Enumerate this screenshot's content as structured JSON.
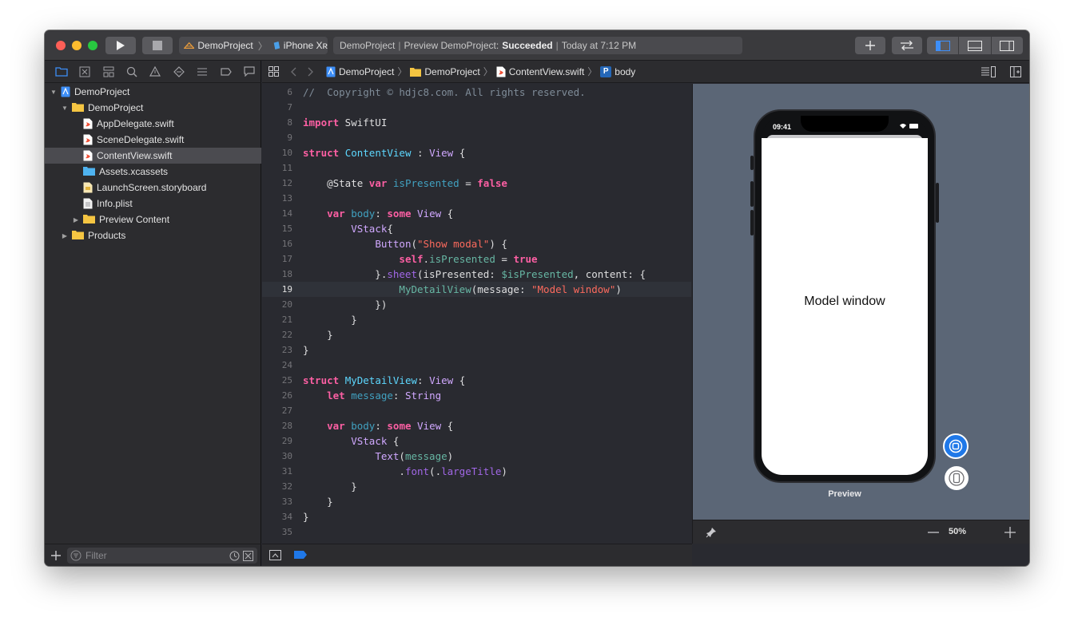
{
  "toolbar": {
    "scheme_project": "DemoProject",
    "scheme_device": "iPhone Xʀ",
    "status_project": "DemoProject",
    "status_message_prefix": "Preview DemoProject:",
    "status_result": "Succeeded",
    "status_time": "Today at 7:12 PM"
  },
  "navigator": {
    "items": [
      {
        "label": "DemoProject",
        "depth": 0,
        "kind": "project",
        "disclosure": "open"
      },
      {
        "label": "DemoProject",
        "depth": 1,
        "kind": "folder",
        "disclosure": "open"
      },
      {
        "label": "AppDelegate.swift",
        "depth": 2,
        "kind": "swift"
      },
      {
        "label": "SceneDelegate.swift",
        "depth": 2,
        "kind": "swift"
      },
      {
        "label": "ContentView.swift",
        "depth": 2,
        "kind": "swift",
        "selected": true
      },
      {
        "label": "Assets.xcassets",
        "depth": 2,
        "kind": "assets"
      },
      {
        "label": "LaunchScreen.storyboard",
        "depth": 2,
        "kind": "storyboard"
      },
      {
        "label": "Info.plist",
        "depth": 2,
        "kind": "plist"
      },
      {
        "label": "Preview Content",
        "depth": 2,
        "kind": "folder",
        "disclosure": "closed"
      },
      {
        "label": "Products",
        "depth": 1,
        "kind": "folder",
        "disclosure": "closed"
      }
    ],
    "filter_placeholder": "Filter"
  },
  "jumpbar": {
    "crumbs": [
      "DemoProject",
      "DemoProject",
      "ContentView.swift",
      "body"
    ],
    "symbol_letter": "P"
  },
  "editor": {
    "current_line": 19,
    "lines": [
      {
        "n": "6",
        "tokens": [
          [
            "cm",
            "//  Copyright © hdjc8.com. All rights reserved."
          ]
        ]
      },
      {
        "n": "7",
        "tokens": []
      },
      {
        "n": "8",
        "tokens": [
          [
            "kw",
            "import"
          ],
          [
            "at",
            " SwiftUI"
          ]
        ]
      },
      {
        "n": "9",
        "tokens": []
      },
      {
        "n": "10",
        "tokens": [
          [
            "kw",
            "struct"
          ],
          [
            "at",
            " "
          ],
          [
            "ty",
            "ContentView"
          ],
          [
            "at",
            " : "
          ],
          [
            "pl",
            "View"
          ],
          [
            "at",
            " {"
          ]
        ]
      },
      {
        "n": "11",
        "tokens": []
      },
      {
        "n": "12",
        "tokens": [
          [
            "at",
            "    @State "
          ],
          [
            "kw",
            "var"
          ],
          [
            "at",
            " "
          ],
          [
            "vr",
            "isPresented"
          ],
          [
            "at",
            " = "
          ],
          [
            "kw",
            "false"
          ]
        ]
      },
      {
        "n": "13",
        "tokens": []
      },
      {
        "n": "14",
        "tokens": [
          [
            "at",
            "    "
          ],
          [
            "kw",
            "var"
          ],
          [
            "at",
            " "
          ],
          [
            "vr",
            "body"
          ],
          [
            "at",
            ": "
          ],
          [
            "kw",
            "some"
          ],
          [
            "at",
            " "
          ],
          [
            "pl",
            "View"
          ],
          [
            "at",
            " {"
          ]
        ]
      },
      {
        "n": "15",
        "tokens": [
          [
            "at",
            "        "
          ],
          [
            "pl",
            "VStack"
          ],
          [
            "at",
            "{"
          ]
        ]
      },
      {
        "n": "16",
        "tokens": [
          [
            "at",
            "            "
          ],
          [
            "pl",
            "Button"
          ],
          [
            "at",
            "("
          ],
          [
            "st",
            "\"Show modal\""
          ],
          [
            "at",
            ") {"
          ]
        ]
      },
      {
        "n": "17",
        "tokens": [
          [
            "at",
            "                "
          ],
          [
            "kw",
            "self"
          ],
          [
            "at",
            "."
          ],
          [
            "fn",
            "isPresented"
          ],
          [
            "at",
            " = "
          ],
          [
            "kw",
            "true"
          ]
        ]
      },
      {
        "n": "18",
        "tokens": [
          [
            "at",
            "            }."
          ],
          [
            "cu",
            "sheet"
          ],
          [
            "at",
            "(isPresented: "
          ],
          [
            "fn",
            "$isPresented"
          ],
          [
            "at",
            ", content: {"
          ]
        ]
      },
      {
        "n": "19",
        "tokens": [
          [
            "at",
            "                "
          ],
          [
            "fn",
            "MyDetailView"
          ],
          [
            "at",
            "(message: "
          ],
          [
            "st",
            "\"Model window\""
          ],
          [
            "at",
            ")"
          ]
        ]
      },
      {
        "n": "20",
        "tokens": [
          [
            "at",
            "            })"
          ]
        ]
      },
      {
        "n": "21",
        "tokens": [
          [
            "at",
            "        }"
          ]
        ]
      },
      {
        "n": "22",
        "tokens": [
          [
            "at",
            "    }"
          ]
        ]
      },
      {
        "n": "23",
        "tokens": [
          [
            "at",
            "}"
          ]
        ]
      },
      {
        "n": "24",
        "tokens": []
      },
      {
        "n": "25",
        "tokens": [
          [
            "kw",
            "struct"
          ],
          [
            "at",
            " "
          ],
          [
            "ty",
            "MyDetailView"
          ],
          [
            "at",
            ": "
          ],
          [
            "pl",
            "View"
          ],
          [
            "at",
            " {"
          ]
        ]
      },
      {
        "n": "26",
        "tokens": [
          [
            "at",
            "    "
          ],
          [
            "kw",
            "let"
          ],
          [
            "at",
            " "
          ],
          [
            "vr",
            "message"
          ],
          [
            "at",
            ": "
          ],
          [
            "pl",
            "String"
          ]
        ]
      },
      {
        "n": "27",
        "tokens": []
      },
      {
        "n": "28",
        "tokens": [
          [
            "at",
            "    "
          ],
          [
            "kw",
            "var"
          ],
          [
            "at",
            " "
          ],
          [
            "vr",
            "body"
          ],
          [
            "at",
            ": "
          ],
          [
            "kw",
            "some"
          ],
          [
            "at",
            " "
          ],
          [
            "pl",
            "View"
          ],
          [
            "at",
            " {"
          ]
        ]
      },
      {
        "n": "29",
        "tokens": [
          [
            "at",
            "        "
          ],
          [
            "pl",
            "VStack"
          ],
          [
            "at",
            " {"
          ]
        ]
      },
      {
        "n": "30",
        "tokens": [
          [
            "at",
            "            "
          ],
          [
            "pl",
            "Text"
          ],
          [
            "at",
            "("
          ],
          [
            "fn",
            "message"
          ],
          [
            "at",
            ")"
          ]
        ]
      },
      {
        "n": "31",
        "tokens": [
          [
            "at",
            "                ."
          ],
          [
            "cu",
            "font"
          ],
          [
            "at",
            "(."
          ],
          [
            "cu",
            "largeTitle"
          ],
          [
            "at",
            ")"
          ]
        ]
      },
      {
        "n": "32",
        "tokens": [
          [
            "at",
            "        }"
          ]
        ]
      },
      {
        "n": "33",
        "tokens": [
          [
            "at",
            "    }"
          ]
        ]
      },
      {
        "n": "34",
        "tokens": [
          [
            "at",
            "}"
          ]
        ]
      },
      {
        "n": "35",
        "tokens": []
      }
    ]
  },
  "preview": {
    "status_time": "09:41",
    "modal_text": "Model window",
    "label": "Preview",
    "zoom": "50%"
  },
  "colors": {
    "accent": "#1f78e8",
    "canvas": "#5b6676",
    "keyword": "#fc5fa3",
    "string": "#fc6a5d"
  }
}
